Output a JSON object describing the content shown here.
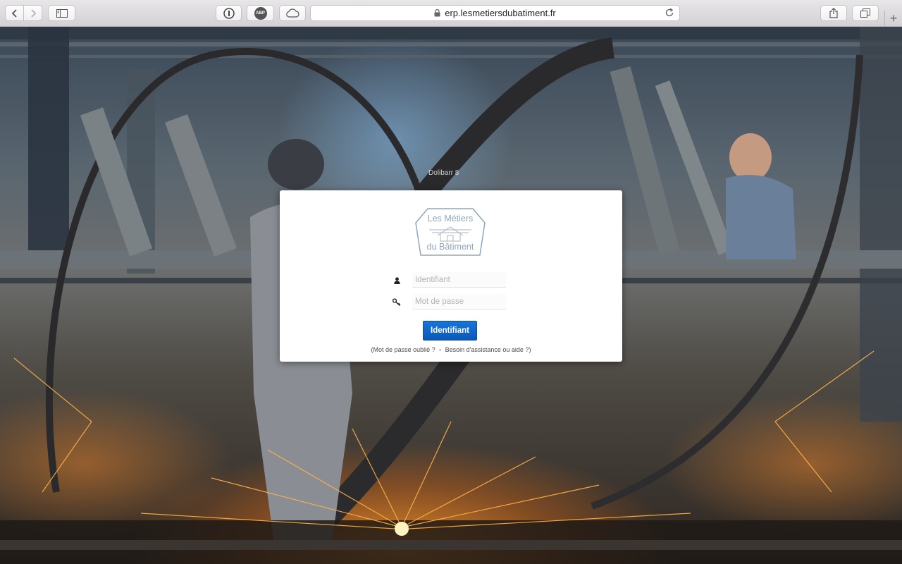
{
  "browser": {
    "url": "erp.lesmetiersdubatiment.fr",
    "abp_label": "ABP",
    "new_tab_label": "+"
  },
  "page": {
    "background_caption": "Dolibarr 8",
    "logo": {
      "line1": "Les Métiers",
      "line2": "du Bâtiment",
      "color": "#8fa6ba"
    },
    "login_form": {
      "username_placeholder": "Identifiant",
      "password_placeholder": "Mot de passe",
      "submit_label": "Identifiant",
      "accent_color": "#0a62c9"
    },
    "links": {
      "open_paren": "(",
      "forgot_password": "Mot de passe oublié ?",
      "separator": "-",
      "help": "Besoin d'assistance ou aide ?",
      "close_paren": ")"
    }
  }
}
